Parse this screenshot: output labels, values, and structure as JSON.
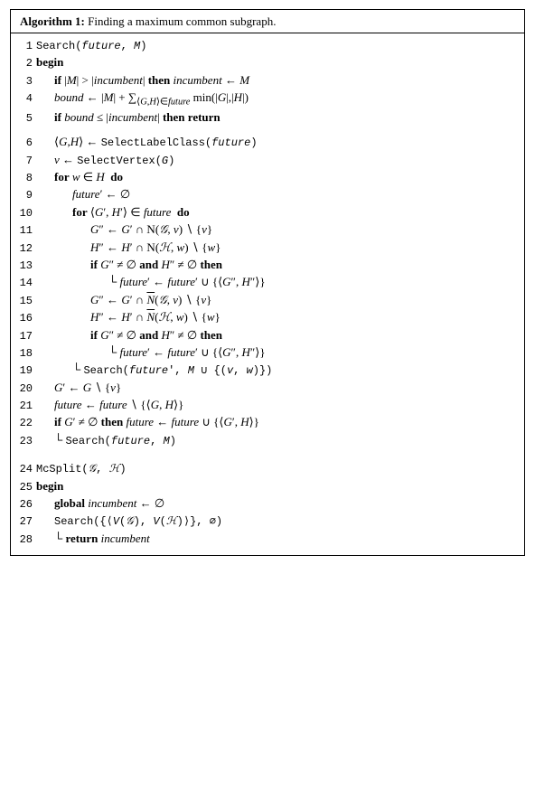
{
  "algorithm": {
    "title": "Algorithm 1:",
    "subtitle": "Finding a maximum common subgraph.",
    "lines": [
      {
        "num": "1",
        "indent": 0,
        "html": "<span class='mono'>Search(<em>future</em>, <em>M</em>)</span>"
      },
      {
        "num": "2",
        "indent": 0,
        "html": "<strong>begin</strong>"
      },
      {
        "num": "3",
        "indent": 1,
        "html": "<strong>if</strong> |<em>M</em>| > |<em>incumbent</em>| <strong>then</strong> <em>incumbent</em> ← <em>M</em>"
      },
      {
        "num": "4",
        "indent": 1,
        "html": "<em>bound</em> ← |<em>M</em>| + ∑<sub>⟨<em>G</em>,<em>H</em>⟩∈<em>future</em></sub> min(|<em>G</em>|,|<em>H</em>|)"
      },
      {
        "num": "5",
        "indent": 1,
        "html": "<strong>if</strong> <em>bound</em> ≤ |<em>incumbent</em>| <strong>then return</strong>"
      },
      {
        "num": "",
        "indent": 0,
        "html": ""
      },
      {
        "num": "6",
        "indent": 1,
        "html": "⟨<em>G</em>,<em>H</em>⟩ ← <span class='mono'>SelectLabelClass(<em>future</em>)</span>"
      },
      {
        "num": "7",
        "indent": 1,
        "html": "<em>v</em> ← <span class='mono'>SelectVertex(<em>G</em>)</span>"
      },
      {
        "num": "8",
        "indent": 1,
        "html": "<strong>for</strong> <em>w</em> ∈ <em>H</em>&nbsp; <strong>do</strong>"
      },
      {
        "num": "9",
        "indent": 2,
        "html": "<em>future</em>′ ← ∅"
      },
      {
        "num": "10",
        "indent": 2,
        "html": "<strong>for</strong> ⟨<em>G</em>′, <em>H</em>′⟩ ∈ <em>future</em>&nbsp; <strong>do</strong>"
      },
      {
        "num": "11",
        "indent": 3,
        "html": "<em>G</em>″ ← <em>G</em>′ ∩ N(<span class='math'>𝒢</span>, <em>v</em>) ∖ {<em>v</em>}"
      },
      {
        "num": "12",
        "indent": 3,
        "html": "<em>H</em>″ ← <em>H</em>′ ∩ N(<span class='math'>ℋ</span>, <em>w</em>) ∖ {<em>w</em>}"
      },
      {
        "num": "13",
        "indent": 3,
        "html": "<strong>if</strong> <em>G</em>″ ≠ ∅ <strong>and</strong> <em>H</em>″ ≠ ∅ <strong>then</strong>"
      },
      {
        "num": "14",
        "indent": 4,
        "html": "└ <em>future</em>′ ← <em>future</em>′ ∪ {⟨<em>G</em>″, <em>H</em>″⟩}"
      },
      {
        "num": "15",
        "indent": 3,
        "html": "<em>G</em>″ ← <em>G</em>′ ∩ <span style='text-decoration:overline;font-style:italic'>N</span>(<span class='math'>𝒢</span>, <em>v</em>) ∖ {<em>v</em>}"
      },
      {
        "num": "16",
        "indent": 3,
        "html": "<em>H</em>″ ← <em>H</em>′ ∩ <span style='text-decoration:overline;font-style:italic'>N</span>(<span class='math'>ℋ</span>, <em>w</em>) ∖ {<em>w</em>}"
      },
      {
        "num": "17",
        "indent": 3,
        "html": "<strong>if</strong> <em>G</em>″ ≠ ∅ <strong>and</strong> <em>H</em>″ ≠ ∅ <strong>then</strong>"
      },
      {
        "num": "18",
        "indent": 4,
        "html": "└ <em>future</em>′ ← <em>future</em>′ ∪ {⟨<em>G</em>″, <em>H</em>″⟩}"
      },
      {
        "num": "19",
        "indent": 2,
        "html": "└ <span class='mono'>Search(<em>future</em>′, <em>M</em> ∪ {(<em>v</em>, <em>w</em>)})</span>"
      },
      {
        "num": "20",
        "indent": 1,
        "html": "<em>G</em>′ ← <em>G</em> ∖ {<em>v</em>}"
      },
      {
        "num": "21",
        "indent": 1,
        "html": "<em>future</em> ← <em>future</em> ∖ {⟨<em>G</em>, <em>H</em>⟩}"
      },
      {
        "num": "22",
        "indent": 1,
        "html": "<strong>if</strong> <em>G</em>′ ≠ ∅ <strong>then</strong> <em>future</em> ← <em>future</em> ∪ {⟨<em>G</em>′, <em>H</em>⟩}"
      },
      {
        "num": "23",
        "indent": 1,
        "html": "└ <span class='mono'>Search(<em>future</em>, <em>M</em>)</span>"
      }
    ],
    "lines2": [
      {
        "num": "24",
        "indent": 0,
        "html": "<span class='mono'>McSplit(<span class='math'>𝒢</span>, <span class='math'>ℋ</span>)</span>"
      },
      {
        "num": "25",
        "indent": 0,
        "html": "<strong>begin</strong>"
      },
      {
        "num": "26",
        "indent": 1,
        "html": "<strong>global</strong> <em>incumbent</em> ← ∅"
      },
      {
        "num": "27",
        "indent": 1,
        "html": "<span class='mono'>Search({⟨<em>V</em>(<span class='math'>𝒢</span>), <em>V</em>(<span class='math'>ℋ</span>)⟩}, ∅)</span>"
      },
      {
        "num": "28",
        "indent": 1,
        "html": "└ <strong>return</strong> <em>incumbent</em>"
      }
    ]
  }
}
